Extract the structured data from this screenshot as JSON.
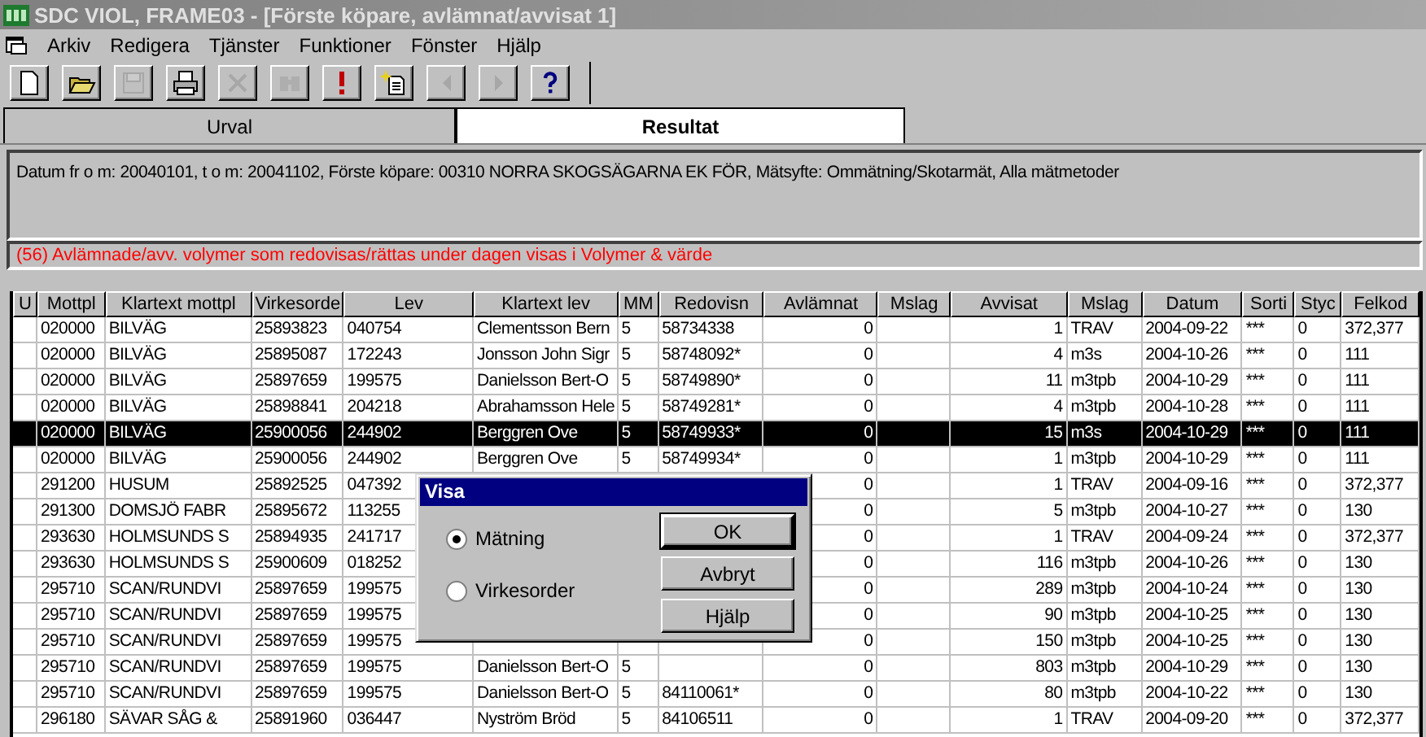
{
  "window": {
    "title": "SDC VIOL, FRAME03 - [Förste köpare, avlämnat/avvisat 1]",
    "active": false
  },
  "menu": [
    "Arkiv",
    "Redigera",
    "Tjänster",
    "Funktioner",
    "Fönster",
    "Hjälp"
  ],
  "toolbar": [
    {
      "kind": "new",
      "disabled": false
    },
    {
      "kind": "open",
      "disabled": false
    },
    {
      "kind": "save",
      "disabled": true
    },
    {
      "kind": "print",
      "disabled": false
    },
    {
      "kind": "delete",
      "disabled": true
    },
    {
      "kind": "find",
      "disabled": true
    },
    {
      "kind": "alert",
      "disabled": false
    },
    {
      "kind": "newitem",
      "disabled": false
    },
    {
      "kind": "prev",
      "disabled": true
    },
    {
      "kind": "next",
      "disabled": true
    },
    {
      "kind": "help",
      "disabled": false
    }
  ],
  "tabs": [
    {
      "label": "Urval",
      "selected": false
    },
    {
      "label": "Resultat",
      "selected": true
    }
  ],
  "criteria": "Datum fr o m: 20040101,  t o m: 20041102, Förste köpare: 00310 NORRA SKOGSÄGARNA EK FÖR, Mätsyfte: Ommätning/Skotarmät, Alla mätmetoder",
  "notice": "(56) Avlämnade/avv. volymer som redovisas/rättas under dagen visas i Volymer & värde",
  "table": {
    "columns": [
      "U",
      "Mottpl",
      "Klartext mottpl",
      "Virkesorde",
      "Lev",
      "Klartext lev",
      "MM",
      "Redovisn",
      "Avlämnat",
      "Mslag",
      "Avvisat",
      "Mslag",
      "Datum",
      "Sorti",
      "Styc",
      "Felkod"
    ],
    "rows": [
      {
        "selected": false,
        "mottpl": "020000",
        "klartext_mottpl": "BILVÄG",
        "virkesorde": "25893823",
        "lev": "040754",
        "klartext_lev": "Clementsson Bern",
        "mm": "5",
        "redovisn": "58734338",
        "avlamnat": "0",
        "avvisat": "1",
        "mslag": "TRAV",
        "datum": "2004-09-22",
        "sorti": "***",
        "styc": "0",
        "felkod": "372,377"
      },
      {
        "selected": false,
        "mottpl": "020000",
        "klartext_mottpl": "BILVÄG",
        "virkesorde": "25895087",
        "lev": "172243",
        "klartext_lev": "Jonsson John Sigr",
        "mm": "5",
        "redovisn": "58748092*",
        "avlamnat": "0",
        "avvisat": "4",
        "mslag": "m3s",
        "datum": "2004-10-26",
        "sorti": "***",
        "styc": "0",
        "felkod": "111"
      },
      {
        "selected": false,
        "mottpl": "020000",
        "klartext_mottpl": "BILVÄG",
        "virkesorde": "25897659",
        "lev": "199575",
        "klartext_lev": "Danielsson Bert-O",
        "mm": "5",
        "redovisn": "58749890*",
        "avlamnat": "0",
        "avvisat": "11",
        "mslag": "m3tpb",
        "datum": "2004-10-29",
        "sorti": "***",
        "styc": "0",
        "felkod": "111"
      },
      {
        "selected": false,
        "mottpl": "020000",
        "klartext_mottpl": "BILVÄG",
        "virkesorde": "25898841",
        "lev": "204218",
        "klartext_lev": "Abrahamsson Hele",
        "mm": "5",
        "redovisn": "58749281*",
        "avlamnat": "0",
        "avvisat": "4",
        "mslag": "m3tpb",
        "datum": "2004-10-28",
        "sorti": "***",
        "styc": "0",
        "felkod": "111"
      },
      {
        "selected": true,
        "mottpl": "020000",
        "klartext_mottpl": "BILVÄG",
        "virkesorde": "25900056",
        "lev": "244902",
        "klartext_lev": "Berggren Ove",
        "mm": "5",
        "redovisn": "58749933*",
        "avlamnat": "0",
        "avvisat": "15",
        "mslag": "m3s",
        "datum": "2004-10-29",
        "sorti": "***",
        "styc": "0",
        "felkod": "111"
      },
      {
        "selected": false,
        "mottpl": "020000",
        "klartext_mottpl": "BILVÄG",
        "virkesorde": "25900056",
        "lev": "244902",
        "klartext_lev": "Berggren Ove",
        "mm": "5",
        "redovisn": "58749934*",
        "avlamnat": "0",
        "avvisat": "1",
        "mslag": "m3tpb",
        "datum": "2004-10-29",
        "sorti": "***",
        "styc": "0",
        "felkod": "111"
      },
      {
        "selected": false,
        "mottpl": "291200",
        "klartext_mottpl": "HUSUM",
        "virkesorde": "25892525",
        "lev": "047392",
        "avlamnat": "0",
        "avvisat": "1",
        "mslag": "TRAV",
        "datum": "2004-09-16",
        "sorti": "***",
        "styc": "0",
        "felkod": "372,377"
      },
      {
        "selected": false,
        "mottpl": "291300",
        "klartext_mottpl": "DOMSJÖ FABR",
        "virkesorde": "25895672",
        "lev": "113255",
        "avlamnat": "0",
        "avvisat": "5",
        "mslag": "m3tpb",
        "datum": "2004-10-27",
        "sorti": "***",
        "styc": "0",
        "felkod": "130"
      },
      {
        "selected": false,
        "mottpl": "293630",
        "klartext_mottpl": "HOLMSUNDS S",
        "virkesorde": "25894935",
        "lev": "241717",
        "avlamnat": "0",
        "avvisat": "1",
        "mslag": "TRAV",
        "datum": "2004-09-24",
        "sorti": "***",
        "styc": "0",
        "felkod": "372,377"
      },
      {
        "selected": false,
        "mottpl": "293630",
        "klartext_mottpl": "HOLMSUNDS S",
        "virkesorde": "25900609",
        "lev": "018252",
        "avlamnat": "0",
        "avvisat": "116",
        "mslag": "m3tpb",
        "datum": "2004-10-26",
        "sorti": "***",
        "styc": "0",
        "felkod": "130"
      },
      {
        "selected": false,
        "mottpl": "295710",
        "klartext_mottpl": "SCAN/RUNDVI",
        "virkesorde": "25897659",
        "lev": "199575",
        "avlamnat": "0",
        "avvisat": "289",
        "mslag": "m3tpb",
        "datum": "2004-10-24",
        "sorti": "***",
        "styc": "0",
        "felkod": "130"
      },
      {
        "selected": false,
        "mottpl": "295710",
        "klartext_mottpl": "SCAN/RUNDVI",
        "virkesorde": "25897659",
        "lev": "199575",
        "avlamnat": "0",
        "avvisat": "90",
        "mslag": "m3tpb",
        "datum": "2004-10-25",
        "sorti": "***",
        "styc": "0",
        "felkod": "130"
      },
      {
        "selected": false,
        "mottpl": "295710",
        "klartext_mottpl": "SCAN/RUNDVI",
        "virkesorde": "25897659",
        "lev": "199575",
        "avlamnat": "0",
        "avvisat": "150",
        "mslag": "m3tpb",
        "datum": "2004-10-25",
        "sorti": "***",
        "styc": "0",
        "felkod": "130"
      },
      {
        "selected": false,
        "mottpl": "295710",
        "klartext_mottpl": "SCAN/RUNDVI",
        "virkesorde": "25897659",
        "lev": "199575",
        "klartext_lev": "Danielsson Bert-O",
        "mm": "5",
        "avlamnat": "0",
        "avvisat": "803",
        "mslag": "m3tpb",
        "datum": "2004-10-29",
        "sorti": "***",
        "styc": "0",
        "felkod": "130"
      },
      {
        "selected": false,
        "mottpl": "295710",
        "klartext_mottpl": "SCAN/RUNDVI",
        "virkesorde": "25897659",
        "lev": "199575",
        "klartext_lev": "Danielsson Bert-O",
        "mm": "5",
        "redovisn": "84110061*",
        "avlamnat": "0",
        "avvisat": "80",
        "mslag": "m3tpb",
        "datum": "2004-10-22",
        "sorti": "***",
        "styc": "0",
        "felkod": "130"
      },
      {
        "selected": false,
        "mottpl": "296180",
        "klartext_mottpl": "SÄVAR SÅG &",
        "virkesorde": "25891960",
        "lev": "036447",
        "klartext_lev": "Nyström Bröd",
        "mm": "5",
        "redovisn": "84106511",
        "avlamnat": "0",
        "avvisat": "1",
        "mslag": "TRAV",
        "datum": "2004-09-20",
        "sorti": "***",
        "styc": "0",
        "felkod": "372,377"
      }
    ]
  },
  "dialog": {
    "title": "Visa",
    "options": [
      {
        "label": "Mätning",
        "selected": true
      },
      {
        "label": "Virkesorder",
        "selected": false
      }
    ],
    "buttons": [
      {
        "label": "OK",
        "default": true
      },
      {
        "label": "Avbryt",
        "default": false
      },
      {
        "label": "Hjälp",
        "default": false
      }
    ]
  }
}
